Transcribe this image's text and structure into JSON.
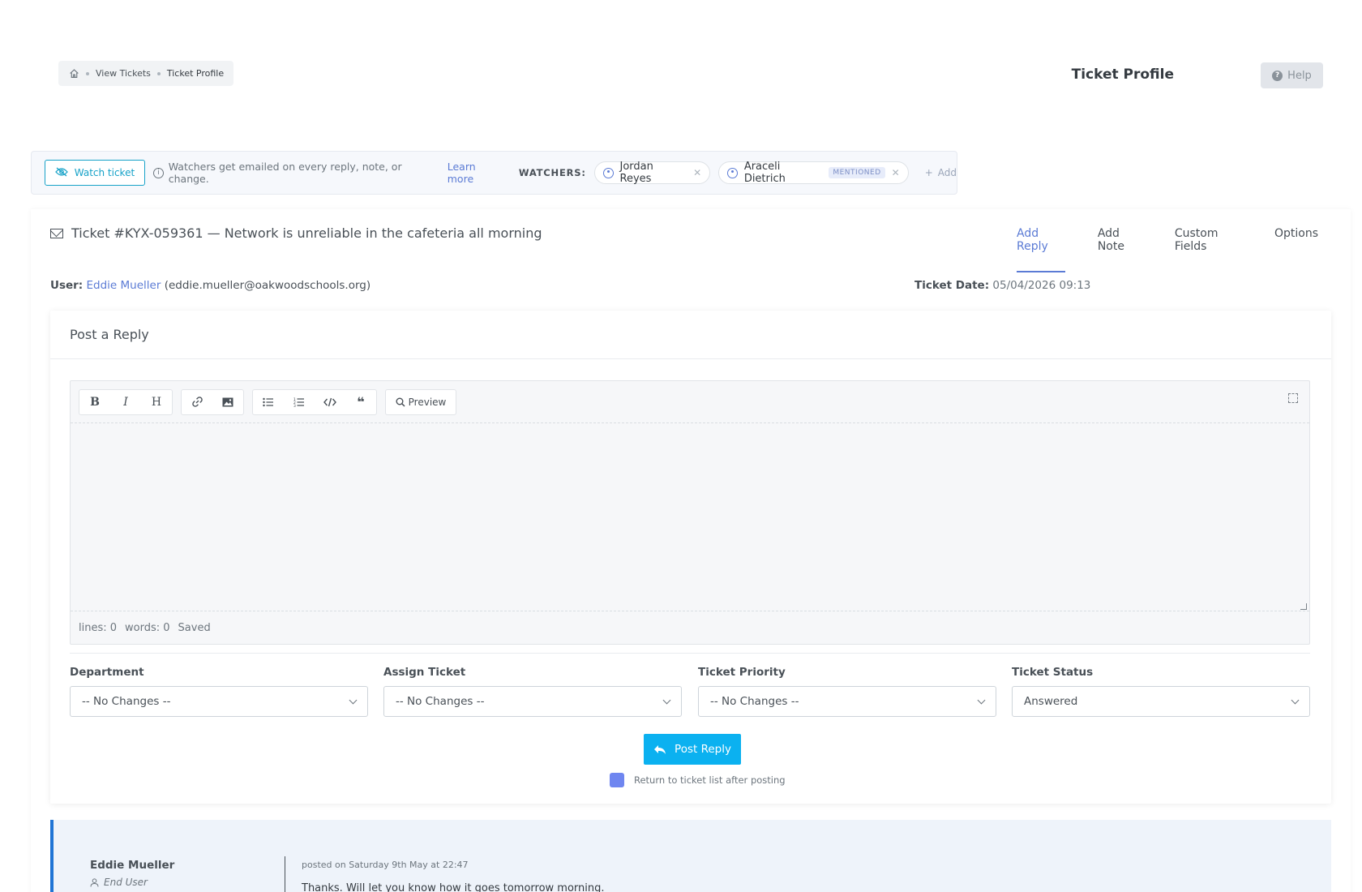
{
  "breadcrumb": {
    "items": [
      "View Tickets",
      "Ticket Profile"
    ]
  },
  "header": {
    "title": "Ticket Profile",
    "help_label": "Help"
  },
  "watch_bar": {
    "watch_button": "Watch ticket",
    "info_text": "Watchers get emailed on every reply, note, or change.",
    "learn_more": "Learn more",
    "watchers_label": "WATCHERS:",
    "watchers": [
      {
        "name": "Jordan Reyes",
        "badge": ""
      },
      {
        "name": "Araceli Dietrich",
        "badge": "MENTIONED"
      }
    ],
    "add_label": "Add"
  },
  "ticket": {
    "title": "Ticket #KYX-059361 — Network is unreliable in the cafeteria all morning",
    "user_label": "User:",
    "user_name": "Eddie Mueller",
    "user_email": "(eddie.mueller@oakwoodschools.org)",
    "date_label": "Ticket Date:",
    "date_value": "05/04/2026 09:13"
  },
  "tabs": [
    "Add Reply",
    "Add Note",
    "Custom Fields",
    "Options"
  ],
  "reply": {
    "heading": "Post a Reply",
    "toolbar": {
      "preview_label": "Preview"
    },
    "status": {
      "lines": "lines: 0",
      "words": "words: 0",
      "saved": "Saved"
    },
    "fields": [
      {
        "label": "Department",
        "value": "-- No Changes --"
      },
      {
        "label": "Assign Ticket",
        "value": "-- No Changes --"
      },
      {
        "label": "Ticket Priority",
        "value": "-- No Changes --"
      },
      {
        "label": "Ticket Status",
        "value": "Answered"
      }
    ],
    "post_button": "Post Reply",
    "return_label": "Return to ticket list after posting"
  },
  "entry": {
    "author": "Eddie Mueller",
    "role": "End User",
    "posted": "posted on Saturday 9th May at 22:47",
    "message": "Thanks. Will let you know how it goes tomorrow morning."
  },
  "colors": {
    "accent": "#5b7bd5",
    "post_button": "#0bb1f0",
    "watch": "#17a2c8",
    "entry_border": "#1f74d5"
  }
}
